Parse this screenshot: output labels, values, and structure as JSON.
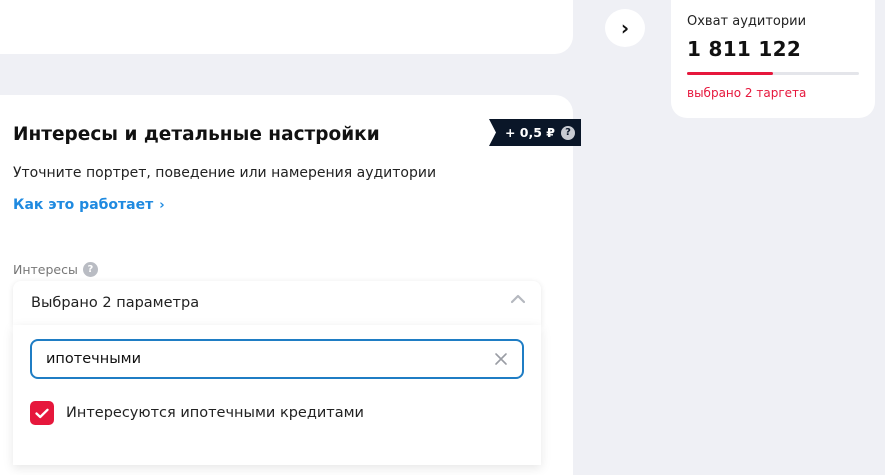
{
  "reach": {
    "title": "Охват аудитории",
    "value": "1 811 122",
    "progress_fraction": 0.5,
    "selected_text": "выбрано 2 таргета",
    "accent_color": "#e6173c"
  },
  "collapse_button": {
    "icon": "chevron-right-icon",
    "glyph": "›"
  },
  "section": {
    "price_tag": "+ 0,5 ₽",
    "price_help_glyph": "?",
    "title": "Интересы и детальные настройки",
    "description": "Уточните портрет, поведение или намерения аудитории",
    "how_link": "Как это работает",
    "how_link_glyph": "›",
    "link_color": "#1f8ae0"
  },
  "interests": {
    "label": "Интересы",
    "help_glyph": "?",
    "selected_value": "Выбрано 2 параметра",
    "search_value": "ипотечными",
    "options": [
      {
        "label": "Интересуются ипотечными кредитами",
        "checked": true
      }
    ]
  }
}
